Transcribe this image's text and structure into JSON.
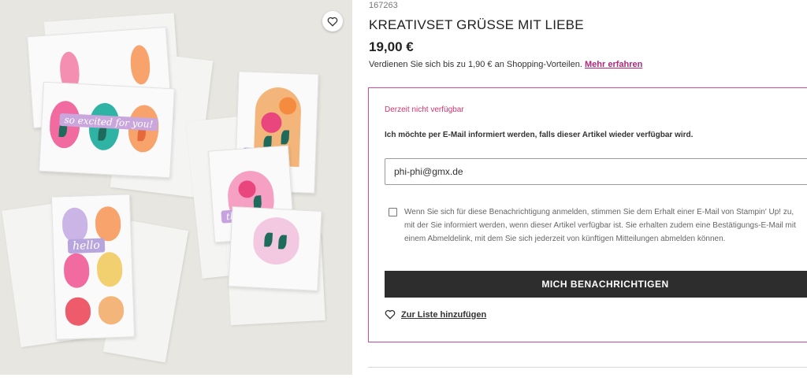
{
  "product": {
    "sku": "167263",
    "title": "KREATIVSET GRÜSSE MIT LIEBE",
    "price": "19,00 €",
    "rewards_text": "Verdienen Sie sich bis zu 1,90 € an Shopping-Vorteilen.",
    "rewards_link": "Mehr erfahren",
    "image_strip_texts": [
      "so excited for you!",
      "thanks",
      "hello",
      "thanks"
    ]
  },
  "notify": {
    "status": "Derzeit nicht verfügbar",
    "prompt": "Ich möchte per E-Mail informiert werden, falls dieser Artikel wieder verfügbar wird.",
    "email_value": "phi-phi@gmx.de",
    "consent_text": "Wenn Sie sich für diese Benachrichtigung anmelden, stimmen Sie dem Erhalt einer E-Mail von Stampin' Up! zu, mit der Sie informiert werden, wenn dieser Artikel verfügbar ist. Sie erhalten zudem eine Bestätigungs-E-Mail mit einem Abmeldelink, mit dem Sie sich jederzeit von künftigen Mitteilungen abmelden können.",
    "button_label": "MICH BENACHRICHTIGEN",
    "wishlist_label": "Zur Liste hinzufügen"
  },
  "icons": {
    "favorite": "heart-outline-icon",
    "wishlist": "heart-outline-icon"
  },
  "colors": {
    "accent": "#b3267d",
    "border": "#d14a99",
    "button": "#2d2d2d",
    "status": "#d0336d"
  }
}
